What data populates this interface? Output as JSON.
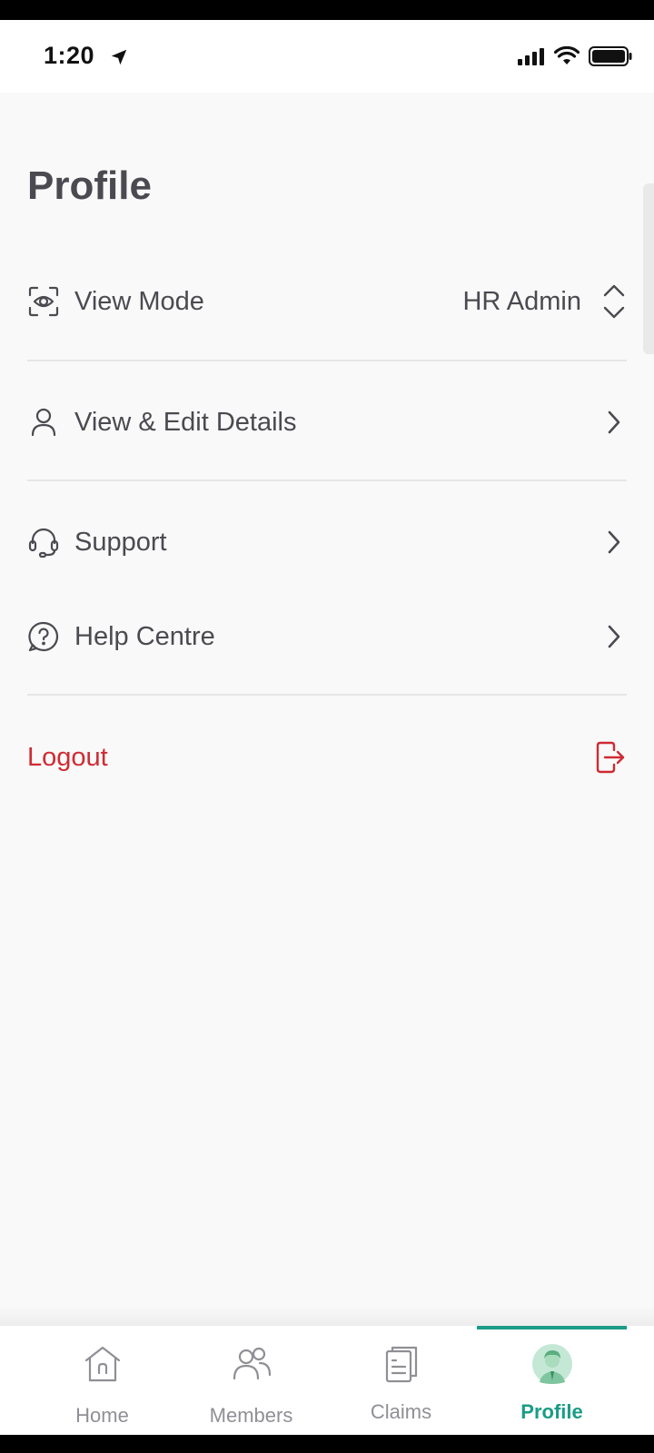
{
  "status": {
    "time": "1:20",
    "icons": [
      "location-arrow-icon",
      "cellular-signal-icon",
      "wifi-icon",
      "battery-icon"
    ]
  },
  "page": {
    "title": "Profile"
  },
  "menu": {
    "view_mode": {
      "label": "View Mode",
      "value": "HR Admin",
      "icon": "eye-icon"
    },
    "edit_details": {
      "label": "View & Edit Details",
      "icon": "user-icon"
    },
    "support": {
      "label": "Support",
      "icon": "headset-icon"
    },
    "help": {
      "label": "Help Centre",
      "icon": "question-circle-icon"
    },
    "logout": {
      "label": "Logout",
      "icon": "logout-icon"
    }
  },
  "tabs": [
    {
      "label": "Home",
      "icon": "home-icon",
      "active": false
    },
    {
      "label": "Members",
      "icon": "members-icon",
      "active": false
    },
    {
      "label": "Claims",
      "icon": "claims-icon",
      "active": false
    },
    {
      "label": "Profile",
      "icon": "profile-avatar-icon",
      "active": true
    }
  ],
  "colors": {
    "accent": "#1a9c86",
    "danger": "#cf2b33",
    "text": "#4a4a50",
    "muted": "#8f8f95",
    "background": "#f9f9f9"
  }
}
